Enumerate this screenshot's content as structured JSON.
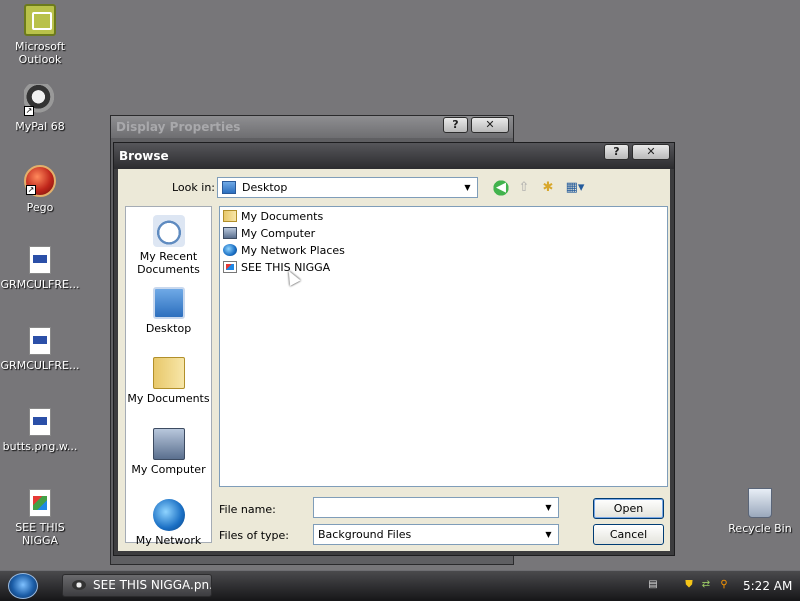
{
  "desktop": {
    "icons": [
      {
        "label": "Microsoft Outlook",
        "icon": "outlook-icon"
      },
      {
        "label": "MyPal 68",
        "icon": "mypal-icon"
      },
      {
        "label": "Pego",
        "icon": "pego-icon"
      },
      {
        "label": "GRMCULFRE...",
        "icon": "document-icon"
      },
      {
        "label": "GRMCULFRE...",
        "icon": "document-icon"
      },
      {
        "label": "butts.png.w...",
        "icon": "document-icon"
      },
      {
        "label": "SEE THIS NIGGA",
        "icon": "image-file-icon"
      },
      {
        "label": "Recycle Bin",
        "icon": "recycle-bin-icon"
      }
    ]
  },
  "back_window": {
    "title": "Display Properties",
    "help_label": "?",
    "close_label": "✕"
  },
  "dialog": {
    "title": "Browse",
    "help_label": "?",
    "close_label": "✕",
    "lookin_label": "Look in:",
    "lookin_value": "Desktop",
    "places": [
      {
        "label": "My Recent Documents"
      },
      {
        "label": "Desktop"
      },
      {
        "label": "My Documents"
      },
      {
        "label": "My Computer"
      },
      {
        "label": "My Network"
      }
    ],
    "files": [
      {
        "name": "My Documents",
        "icon": "folder-icon"
      },
      {
        "name": "My Computer",
        "icon": "computer-icon"
      },
      {
        "name": "My Network Places",
        "icon": "network-icon"
      },
      {
        "name": "SEE THIS NIGGA",
        "icon": "image-file-icon"
      }
    ],
    "filename_label": "File name:",
    "filename_value": "",
    "filetype_label": "Files of type:",
    "filetype_value": "Background Files",
    "open_label": "Open",
    "cancel_label": "Cancel"
  },
  "taskbar": {
    "task_label": "SEE THIS NIGGA.pn...",
    "clock": "5:22 AM"
  }
}
